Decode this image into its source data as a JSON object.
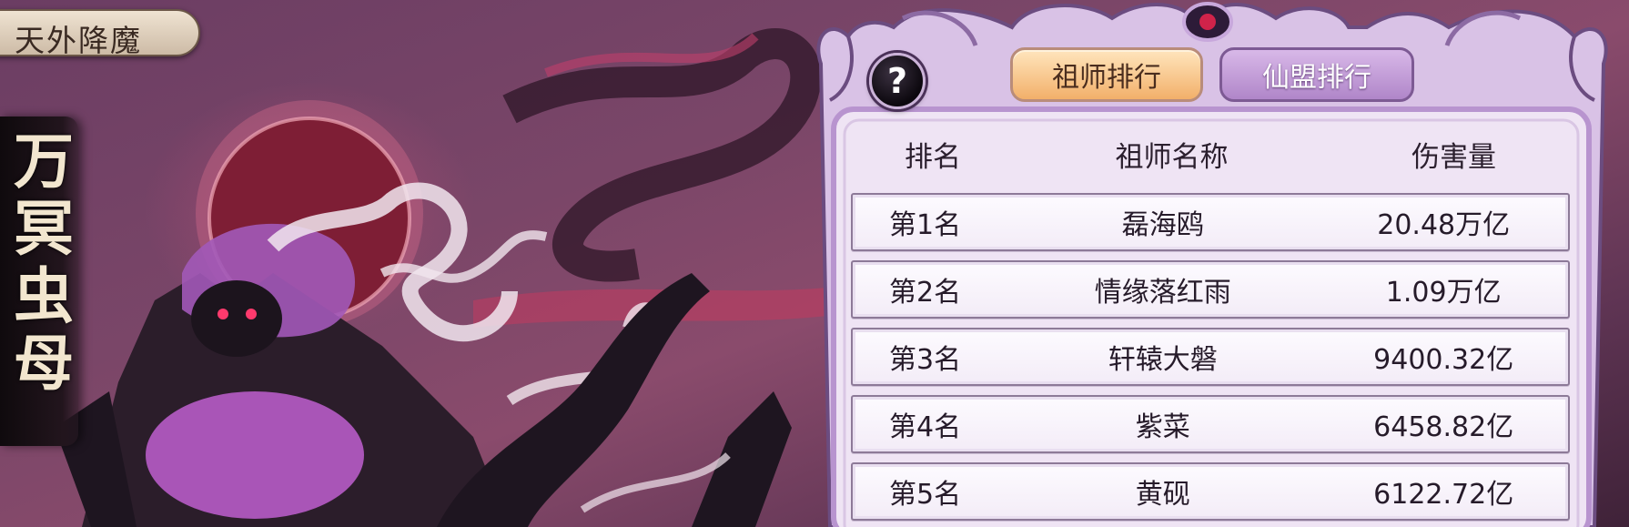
{
  "event": {
    "title": "天外降魔"
  },
  "boss": {
    "name": "万冥虫母"
  },
  "help": {
    "glyph": "?"
  },
  "tabs": [
    {
      "label": "祖师排行",
      "active": true
    },
    {
      "label": "仙盟排行",
      "active": false
    }
  ],
  "table": {
    "headers": {
      "rank": "排名",
      "name": "祖师名称",
      "damage": "伤害量"
    },
    "rows": [
      {
        "rank": "第1名",
        "name": "磊海鸥",
        "damage": "20.48万亿"
      },
      {
        "rank": "第2名",
        "name": "情缘落红雨",
        "damage": "1.09万亿"
      },
      {
        "rank": "第3名",
        "name": "轩辕大磐",
        "damage": "9400.32亿"
      },
      {
        "rank": "第4名",
        "name": "紫菜",
        "damage": "6458.82亿"
      },
      {
        "rank": "第5名",
        "name": "黄砚",
        "damage": "6122.72亿"
      }
    ]
  },
  "colors": {
    "panel_bg": "#efe4f4",
    "panel_border": "#b894cf",
    "tab_active": "#f2b06a",
    "tab_inactive": "#b086c9",
    "boss_label_bg": "#1a1016"
  },
  "icons": {
    "help": "question-mark-icon",
    "frame_gem": "red-gem-icon"
  }
}
